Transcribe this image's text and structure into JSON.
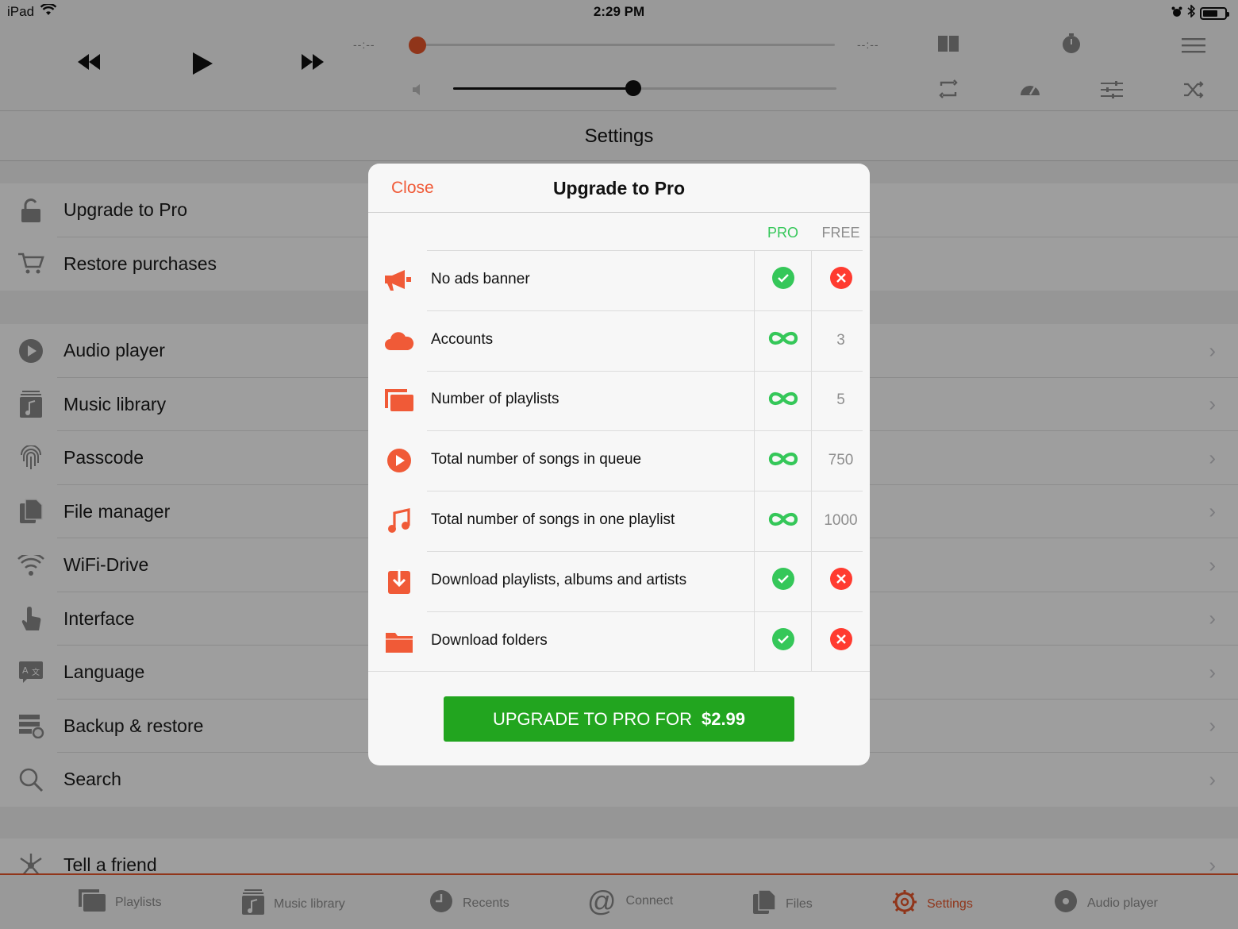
{
  "status": {
    "device": "iPad",
    "time": "2:29 PM"
  },
  "player": {
    "elapsed": "--:--",
    "remaining": "--:--",
    "position_fraction": 0.0,
    "volume_fraction": 0.47
  },
  "nav": {
    "title": "Settings"
  },
  "settings": {
    "purchase_items": [
      {
        "label": "Upgrade to Pro",
        "icon": "lock-open-icon"
      },
      {
        "label": "Restore purchases",
        "icon": "cart-icon"
      }
    ],
    "items": [
      {
        "label": "Audio player",
        "icon": "play-circle-icon"
      },
      {
        "label": "Music library",
        "icon": "music-library-icon"
      },
      {
        "label": "Passcode",
        "icon": "fingerprint-icon"
      },
      {
        "label": "File manager",
        "icon": "files-icon"
      },
      {
        "label": "WiFi-Drive",
        "icon": "wifi-icon"
      },
      {
        "label": "Interface",
        "icon": "hand-tap-icon"
      },
      {
        "label": "Language",
        "icon": "translate-icon"
      },
      {
        "label": "Backup & restore",
        "icon": "backup-icon"
      },
      {
        "label": "Search",
        "icon": "search-icon"
      }
    ],
    "other_items": [
      {
        "label": "Tell a friend",
        "icon": "share-icon"
      }
    ]
  },
  "tabs": [
    {
      "label": "Playlists",
      "icon": "playlists-icon",
      "active": false
    },
    {
      "label": "Music library",
      "icon": "music-library-icon",
      "active": false
    },
    {
      "label": "Recents",
      "icon": "clock-icon",
      "active": false
    },
    {
      "label": "Connect",
      "icon": "at-icon",
      "active": false
    },
    {
      "label": "Files",
      "icon": "files-icon",
      "active": false
    },
    {
      "label": "Settings",
      "icon": "gear-icon",
      "active": true
    },
    {
      "label": "Audio player",
      "icon": "disc-icon",
      "active": false
    }
  ],
  "modal": {
    "close_label": "Close",
    "title": "Upgrade to Pro",
    "col_pro": "PRO",
    "col_free": "FREE",
    "features": [
      {
        "label": "No ads banner",
        "icon": "megaphone-icon",
        "pro": "check",
        "free": "cross"
      },
      {
        "label": "Accounts",
        "icon": "cloud-icon",
        "pro": "infinity",
        "free": "3"
      },
      {
        "label": "Number of playlists",
        "icon": "playlists-icon",
        "pro": "infinity",
        "free": "5"
      },
      {
        "label": "Total number of songs in queue",
        "icon": "play-circle-icon",
        "pro": "infinity",
        "free": "750"
      },
      {
        "label": "Total number of songs in one playlist",
        "icon": "music-note-icon",
        "pro": "infinity",
        "free": "1000"
      },
      {
        "label": "Download playlists, albums and artists",
        "icon": "download-icon",
        "pro": "check",
        "free": "cross"
      },
      {
        "label": "Download folders",
        "icon": "folder-icon",
        "pro": "check",
        "free": "cross"
      }
    ],
    "buy_label": "UPGRADE TO PRO FOR",
    "buy_price": "$2.99"
  },
  "colors": {
    "accent": "#e8562a",
    "pro_green": "#35c759",
    "free_red": "#ff3b30",
    "buy_green": "#22a51f"
  }
}
